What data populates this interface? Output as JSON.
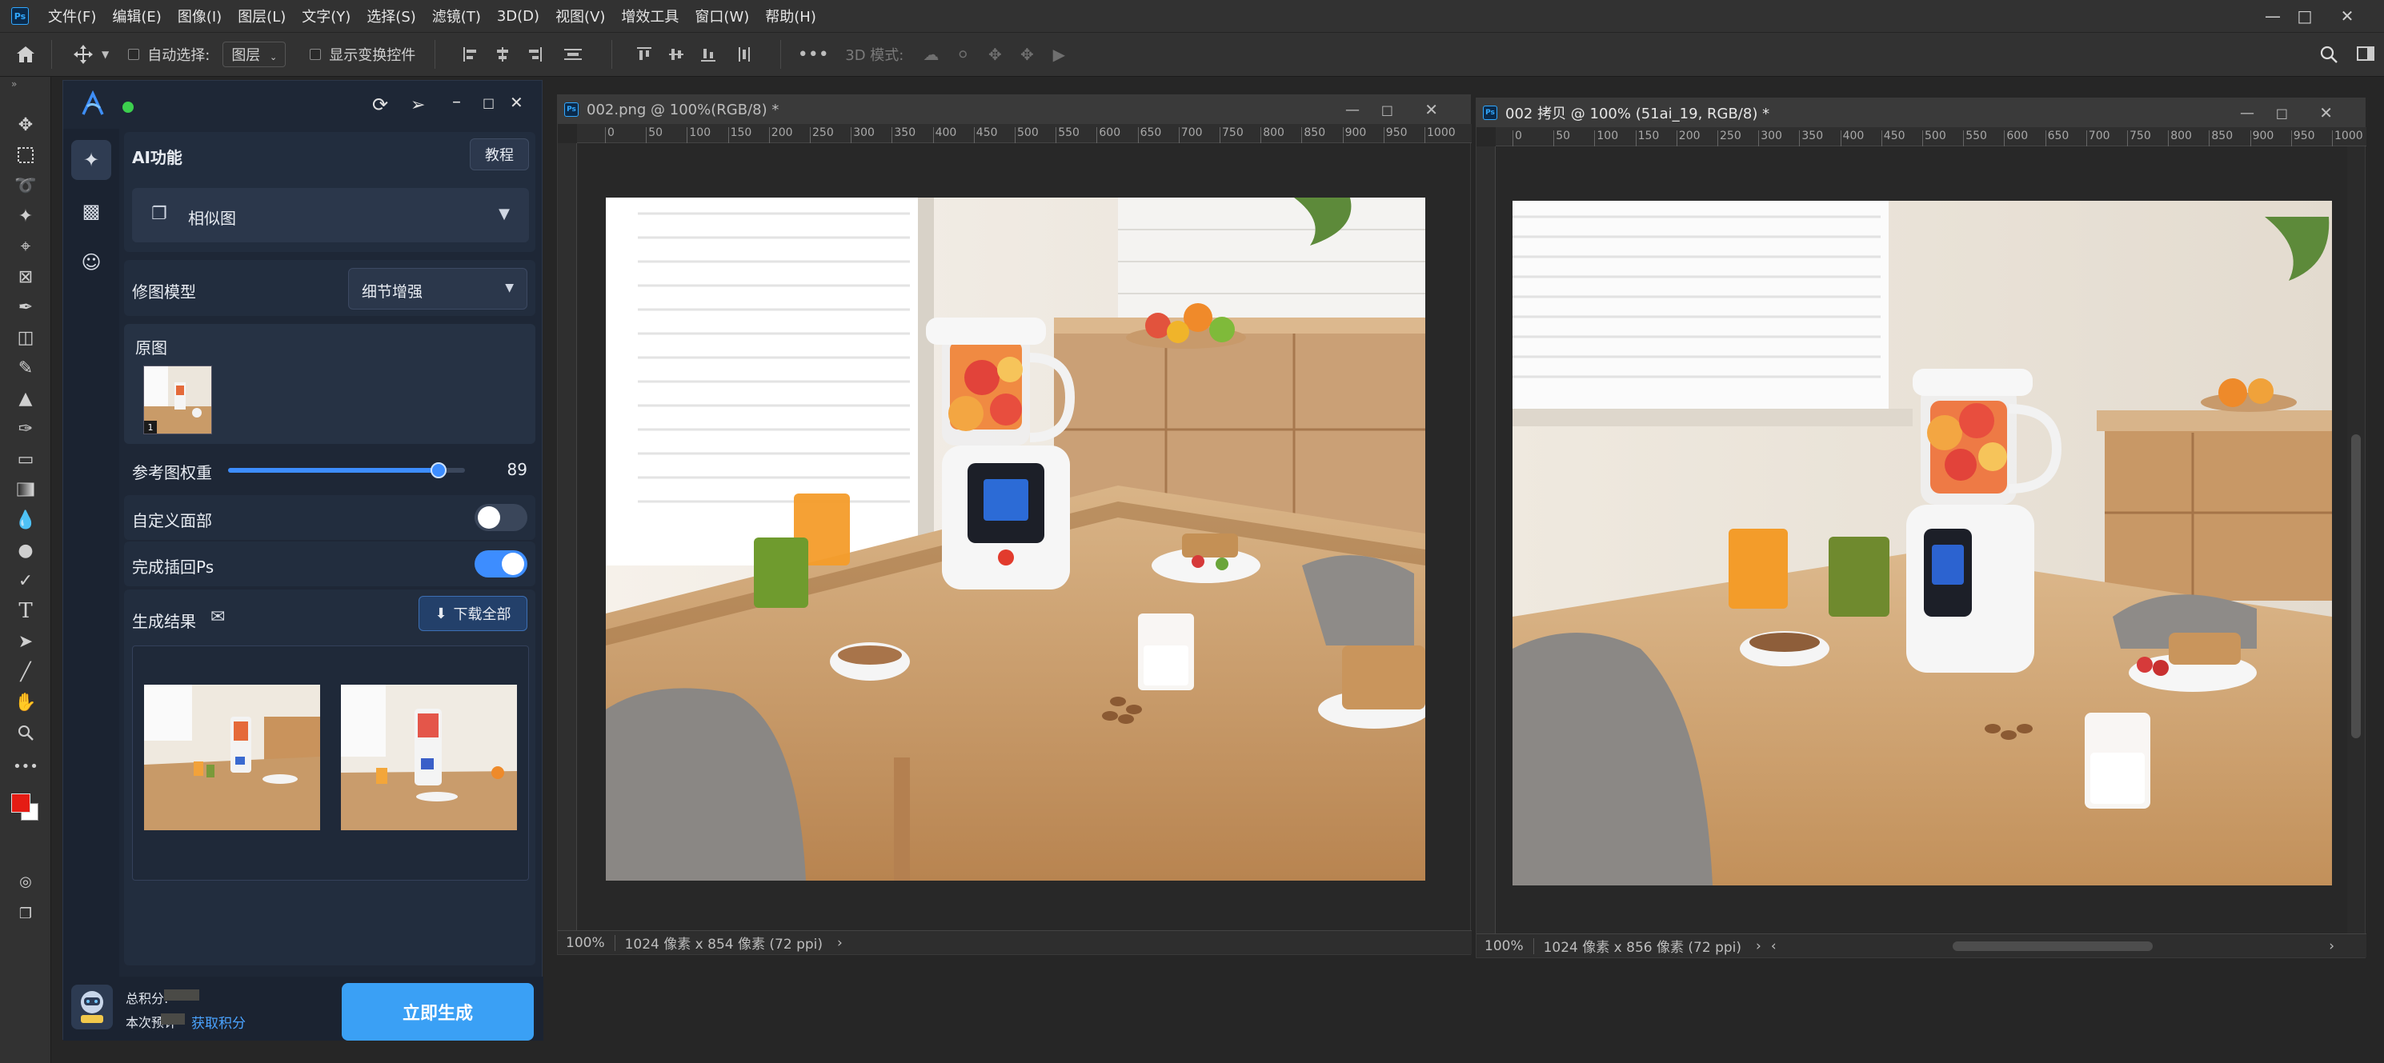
{
  "menubar": {
    "items": [
      "文件(F)",
      "编辑(E)",
      "图像(I)",
      "图层(L)",
      "文字(Y)",
      "选择(S)",
      "滤镜(T)",
      "3D(D)",
      "视图(V)",
      "增效工具",
      "窗口(W)",
      "帮助(H)"
    ]
  },
  "options": {
    "auto_select_label": "自动选择:",
    "auto_select_value": "图层",
    "show_transform_label": "显示变换控件",
    "mode_3d_label": "3D 模式:"
  },
  "panel": {
    "ai_section_title": "AI功能",
    "tutorial_label": "教程",
    "function_select": "相似图",
    "model_label": "修图模型",
    "model_value": "细节增强",
    "original_label": "原图",
    "original_badge": "1",
    "weight_label": "参考图权重",
    "weight_value": "89",
    "weight_fraction": 0.89,
    "custom_face_label": "自定义面部",
    "custom_face_on": false,
    "insert_ps_label": "完成插回Ps",
    "insert_ps_on": true,
    "results_label": "生成结果",
    "download_all_label": "下载全部",
    "total_points_label": "总积分:",
    "estimate_label": "本次预计",
    "get_points_label": "获取积分",
    "generate_label": "立即生成",
    "colors": {
      "accent": "#2f8cff",
      "generate_bg": "#3aa0f5",
      "panel_bg": "#1e2736",
      "online_dot": "#3ccf4e"
    }
  },
  "doc1": {
    "title": "002.png @ 100%(RGB/8) *",
    "zoom": "100%",
    "info": "1024 像素 x 854 像素 (72 ppi)",
    "ruler_ticks": [
      "0",
      "50",
      "100",
      "150",
      "200",
      "250",
      "300",
      "350",
      "400",
      "450",
      "500",
      "550",
      "600",
      "650",
      "700",
      "750",
      "800",
      "850",
      "900",
      "950",
      "1000"
    ]
  },
  "doc2": {
    "title": "002 拷贝 @ 100% (51ai_19, RGB/8) *",
    "zoom": "100%",
    "info": "1024 像素 x 856 像素 (72 ppi)",
    "ruler_ticks": [
      "0",
      "50",
      "100",
      "150",
      "200",
      "250",
      "300",
      "350",
      "400",
      "450",
      "500",
      "550",
      "600",
      "650",
      "700",
      "750",
      "800",
      "850",
      "900",
      "950",
      "1000"
    ]
  }
}
